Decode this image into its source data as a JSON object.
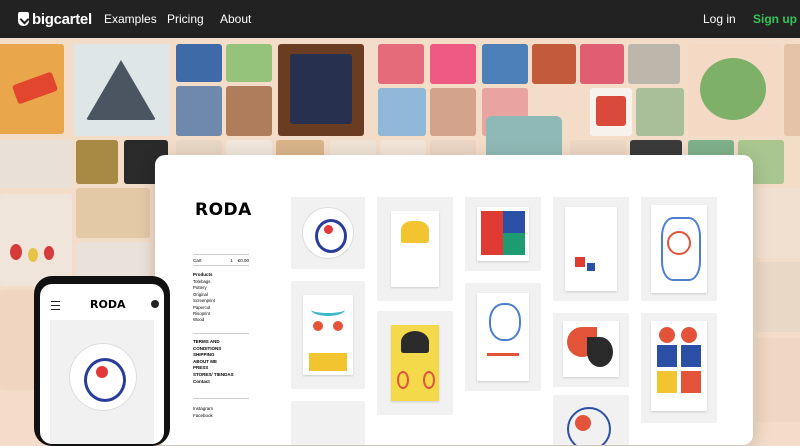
{
  "nav": {
    "logo_text": "bigcartel",
    "examples": "Examples",
    "pricing": "Pricing",
    "about": "About",
    "login": "Log in",
    "signup": "Sign up",
    "signup_color": "#36c25c"
  },
  "store": {
    "brand": "RODA",
    "cart_label": "Cart",
    "cart_count": "1",
    "cart_total": "€0.00",
    "products_heading": "Products",
    "product_categories": [
      "Totebags",
      "Pottery",
      "Original",
      "Screenprint",
      "Papercut",
      "Risoprint",
      "Wood"
    ],
    "links": [
      "TERMS AND",
      "CONDITIONS",
      "SHIPPING",
      "ABOUT ME",
      "PRESS",
      "STORES/ TIENDAS",
      "Contact"
    ],
    "social": [
      "Instagram",
      "Facebook"
    ]
  },
  "phone": {
    "brand": "RODA"
  }
}
